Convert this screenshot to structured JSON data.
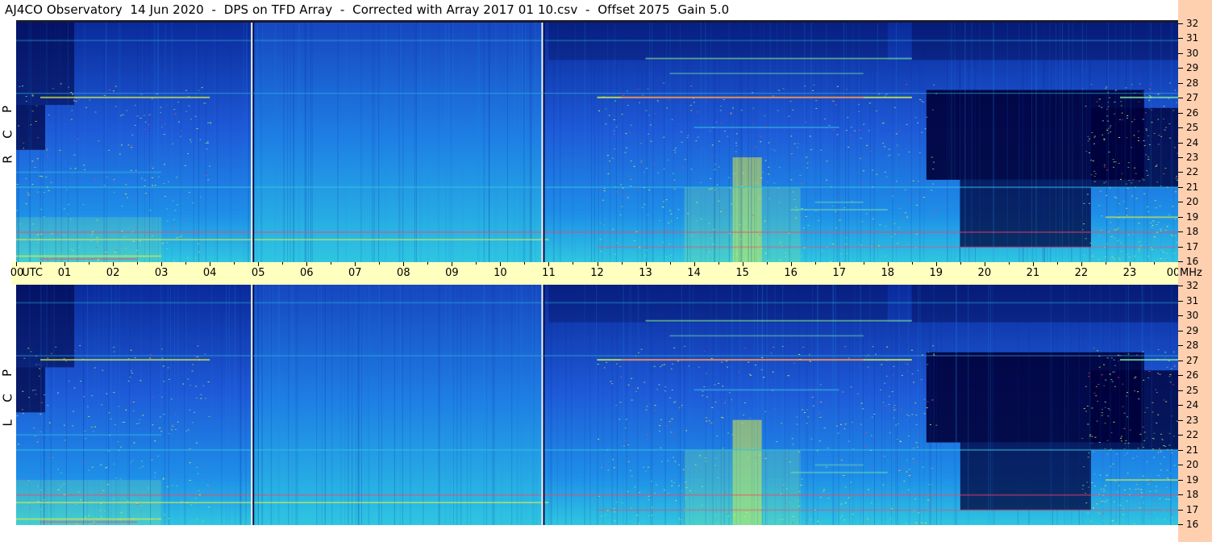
{
  "header": {
    "title": "AJ4CO Observatory  14 Jun 2020  -  DPS on TFD Array  -  Corrected with Array 2017 01 10.csv  -  Offset 2075  Gain 5.0"
  },
  "chart_data": {
    "type": "heatmap",
    "description_of_axes": "time (UTC hours) vs frequency (MHz)",
    "x_axis": {
      "unit": "UTC",
      "labels": [
        "00",
        "UTC",
        "01",
        "02",
        "03",
        "04",
        "05",
        "06",
        "07",
        "08",
        "09",
        "10",
        "11",
        "12",
        "13",
        "14",
        "15",
        "16",
        "17",
        "18",
        "19",
        "20",
        "21",
        "22",
        "23",
        "00"
      ],
      "hours": [
        "00",
        "01",
        "02",
        "03",
        "04",
        "05",
        "06",
        "07",
        "08",
        "09",
        "10",
        "11",
        "12",
        "13",
        "14",
        "15",
        "16",
        "17",
        "18",
        "19",
        "20",
        "21",
        "22",
        "23",
        "00"
      ],
      "range": [
        0,
        24
      ]
    },
    "y_axis": {
      "unit": "MHz",
      "ticks": [
        "32",
        "31",
        "30",
        "29",
        "28",
        "27",
        "26",
        "25",
        "24",
        "23",
        "22",
        "21",
        "20",
        "19",
        "18",
        "17",
        "16"
      ],
      "range": [
        16,
        32
      ]
    },
    "panels": [
      {
        "polarization": "RCP",
        "letters": [
          "P",
          "C",
          "R"
        ]
      },
      {
        "polarization": "LCP",
        "letters": [
          "P",
          "C",
          "L"
        ]
      }
    ],
    "calibration_lines_utc": [
      4.9,
      10.9
    ],
    "colormap": [
      "#00003a",
      "#0a2a9a",
      "#1e5ad8",
      "#1e8fe8",
      "#2fc6e0",
      "#7fe8a0",
      "#e0f040",
      "#ff4060"
    ]
  },
  "labels": {
    "utc": "UTC",
    "mhz": "MHz"
  }
}
